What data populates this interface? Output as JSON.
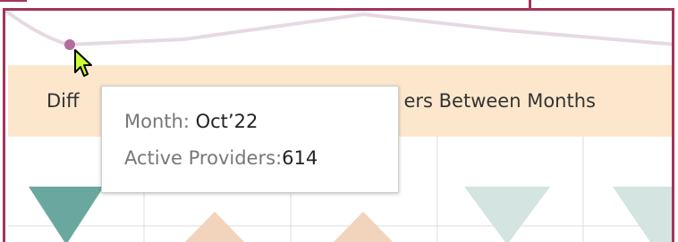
{
  "colors": {
    "frame": "#a3345c",
    "band": "#fde7cc",
    "sparkline": "#e7d9e3",
    "marker": "#b46b9d",
    "tri_teal": "#6aa89f",
    "tri_peach": "#f2d3bb",
    "tri_pale_teal": "#d3e4e1"
  },
  "section": {
    "title": "Difference in Active Providers Between Months",
    "title_visible_left": "Diff",
    "title_visible_right": "ers Between Months"
  },
  "tooltip": {
    "month_label": "Month:",
    "month_value": "Oct’22",
    "providers_label": "Active Providers:",
    "providers_value": "614"
  },
  "triangles": [
    {
      "direction": "down",
      "color": "tri_teal"
    },
    {
      "direction": "up",
      "color": "tri_peach"
    },
    {
      "direction": "up",
      "color": "tri_peach"
    },
    {
      "direction": "down",
      "color": "tri_pale_teal"
    },
    {
      "direction": "down",
      "color": "tri_pale_teal"
    }
  ],
  "cursor": {
    "icon": "mouse-pointer-icon"
  }
}
